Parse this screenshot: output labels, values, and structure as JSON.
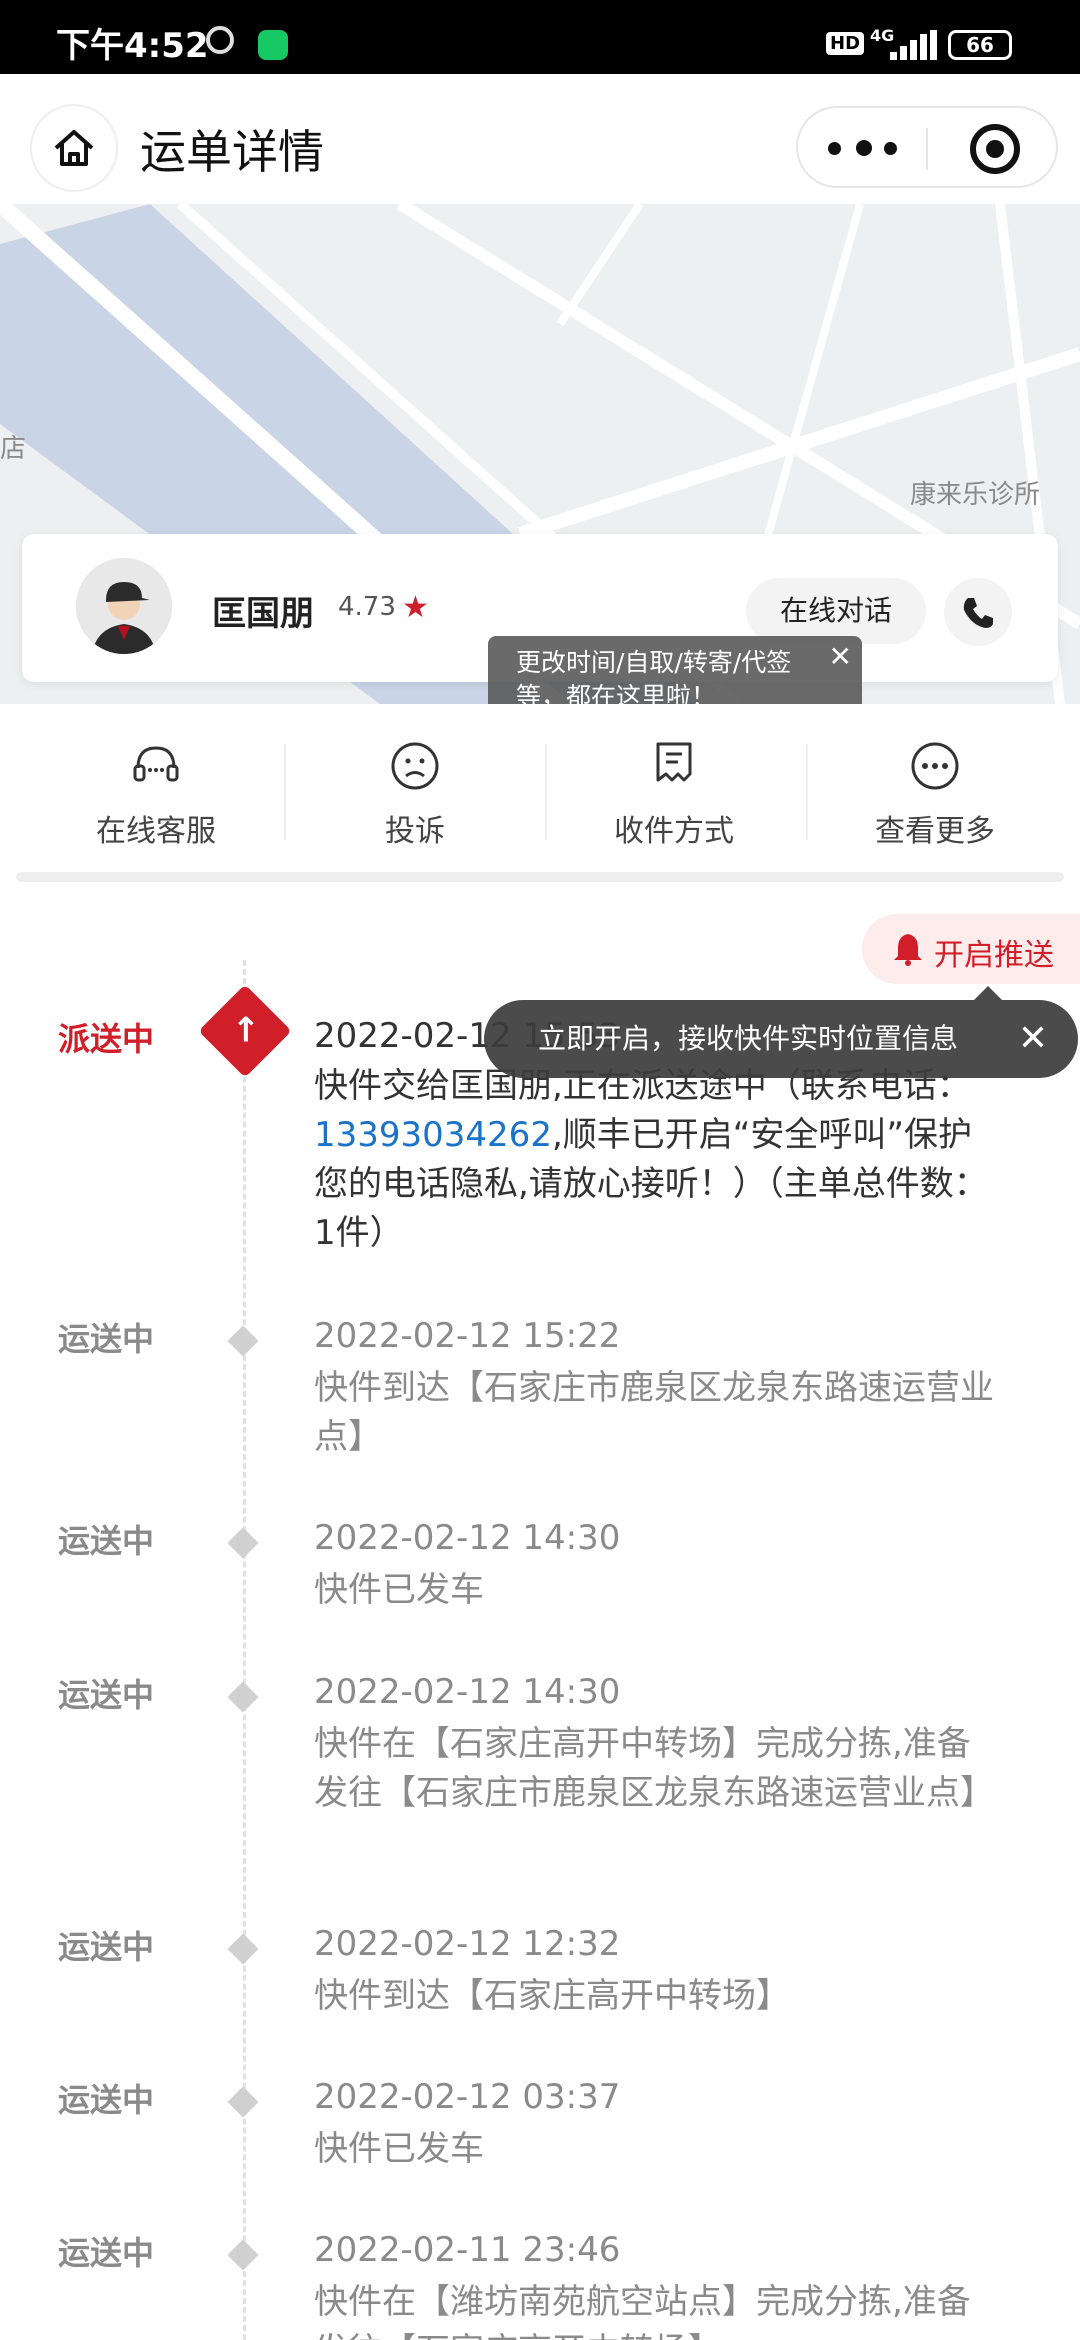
{
  "status_bar": {
    "time": "下午4:52",
    "hd": "HD",
    "network": "4G",
    "battery": "66"
  },
  "header": {
    "title": "运单详情"
  },
  "map": {
    "labels": [
      "店",
      "康来乐诊所"
    ]
  },
  "courier": {
    "name": "匡国朋",
    "rating": "4.73",
    "chat_label": "在线对话"
  },
  "tooltip_modify": {
    "text": "更改时间/自取/转寄/代签等，都在这里啦！",
    "close": "✕"
  },
  "actions": [
    {
      "label": "在线客服",
      "icon": "headset-icon"
    },
    {
      "label": "投诉",
      "icon": "sad-face-icon"
    },
    {
      "label": "收件方式",
      "icon": "receipt-edit-icon"
    },
    {
      "label": "查看更多",
      "icon": "more-circle-icon"
    }
  ],
  "push": {
    "label": "开启推送"
  },
  "tooltip_push": {
    "text": "立即开启，接收快件实时位置信息",
    "close": "✕"
  },
  "timeline": [
    {
      "status": "派送中",
      "time": "2022-02-12 15:53",
      "desc_pre": "快件交给匡国朋,正在派送途中（联系电话：",
      "phone": "13393034262",
      "desc_post": ",顺丰已开启“安全呼叫”保护您的电话隐私,请放心接听！）（主单总件数：1件）"
    },
    {
      "status": "运送中",
      "time": "2022-02-12 15:22",
      "desc": "快件到达【石家庄市鹿泉区龙泉东路速运营业点】"
    },
    {
      "status": "运送中",
      "time": "2022-02-12 14:30",
      "desc": "快件已发车"
    },
    {
      "status": "运送中",
      "time": "2022-02-12 14:30",
      "desc": "快件在【石家庄高开中转场】完成分拣,准备发往【石家庄市鹿泉区龙泉东路速运营业点】"
    },
    {
      "status": "运送中",
      "time": "2022-02-12 12:32",
      "desc": "快件到达【石家庄高开中转场】"
    },
    {
      "status": "运送中",
      "time": "2022-02-12 03:37",
      "desc": "快件已发车"
    },
    {
      "status": "运送中",
      "time": "2022-02-11 23:46",
      "desc": "快件在【潍坊南苑航空站点】完成分拣,准备发往【石家庄高开中转场】"
    }
  ],
  "colors": {
    "accent": "#d11f2a",
    "link": "#1a73c8",
    "muted": "#8a8a8a"
  }
}
